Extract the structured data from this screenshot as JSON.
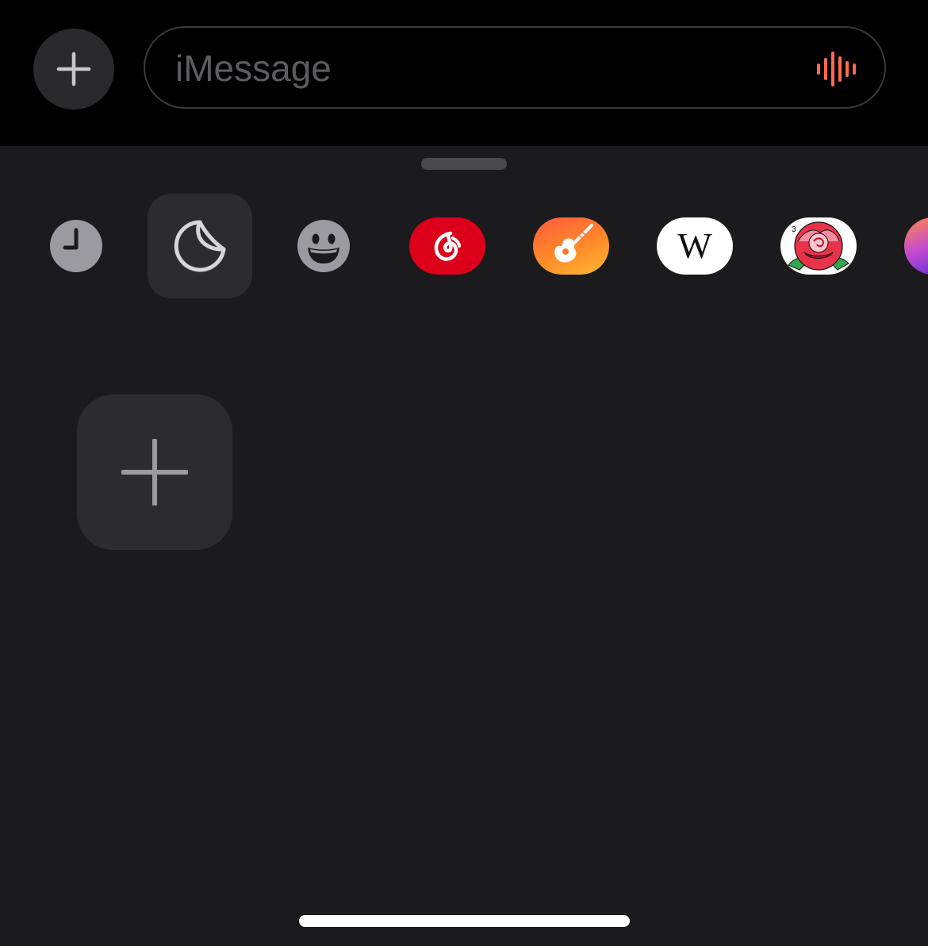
{
  "composer": {
    "add_button_icon": "plus-icon",
    "placeholder": "iMessage",
    "value": "",
    "audio_icon": "waveform-icon",
    "accent_color": "#ff6a4d"
  },
  "app_drawer": {
    "apps": [
      {
        "name": "recents",
        "icon": "clock-icon",
        "selected": false
      },
      {
        "name": "stickers",
        "icon": "sticker-icon",
        "selected": true
      },
      {
        "name": "memoji",
        "icon": "smiley-icon",
        "selected": false
      },
      {
        "name": "netease-cloud-music",
        "icon": "netease-music-icon",
        "selected": false
      },
      {
        "name": "garageband",
        "icon": "garageband-guitar-icon",
        "selected": false
      },
      {
        "name": "wikipedia",
        "icon": "wikipedia-icon",
        "selected": false,
        "glyph": "W"
      },
      {
        "name": "color-by-number",
        "icon": "rose-coloring-icon",
        "selected": false,
        "badge": "3"
      },
      {
        "name": "partial-app",
        "icon": "gradient-app-icon",
        "selected": false
      }
    ],
    "add_sticker_icon": "plus-icon"
  }
}
